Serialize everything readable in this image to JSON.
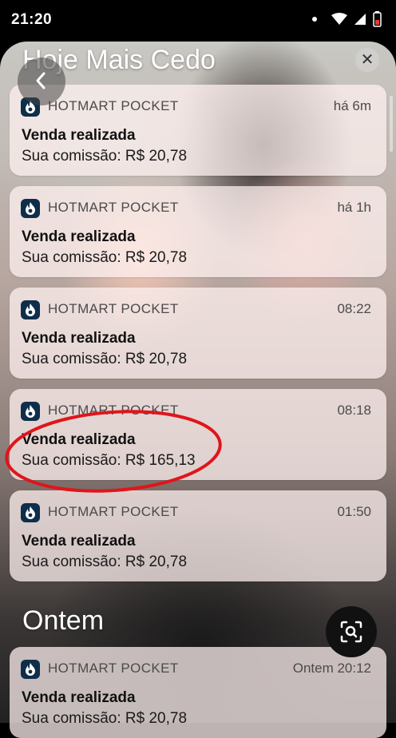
{
  "status_bar": {
    "time": "21:20"
  },
  "sections": {
    "today": "Hoje Mais Cedo",
    "yesterday": "Ontem"
  },
  "notifications": [
    {
      "app": "HOTMART POCKET",
      "time": "há 6m",
      "title": "Venda realizada",
      "body": "Sua comissão: R$ 20,78"
    },
    {
      "app": "HOTMART POCKET",
      "time": "há 1h",
      "title": "Venda realizada",
      "body": "Sua comissão: R$ 20,78"
    },
    {
      "app": "HOTMART POCKET",
      "time": "08:22",
      "title": "Venda realizada",
      "body": "Sua comissão: R$ 20,78"
    },
    {
      "app": "HOTMART POCKET",
      "time": "08:18",
      "title": "Venda realizada",
      "body": "Sua comissão: R$ 165,13",
      "highlighted": true
    },
    {
      "app": "HOTMART POCKET",
      "time": "01:50",
      "title": "Venda realizada",
      "body": "Sua comissão: R$ 20,78"
    },
    {
      "app": "HOTMART POCKET",
      "time": "Ontem 20:12",
      "title": "Venda realizada",
      "body": "Sua comissão: R$ 20,78"
    }
  ],
  "icons": {
    "back": "chevron-left-icon",
    "close": "close-icon",
    "lens": "image-search-icon",
    "app": "hotmart-flame-icon"
  },
  "colors": {
    "highlight_ellipse": "#e0151b",
    "app_icon_bg": "#0e2e4a"
  }
}
